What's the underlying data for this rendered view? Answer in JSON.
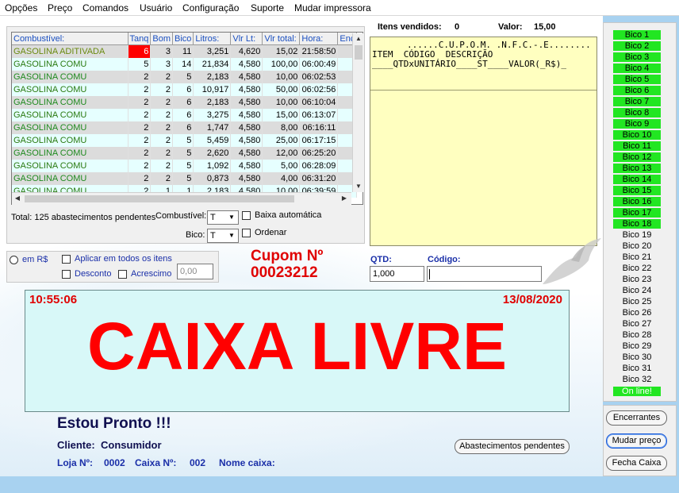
{
  "menu": [
    "Opções",
    "Preço",
    "Comandos",
    "Usuário",
    "Configuração",
    "Suporte",
    "Mudar impressora"
  ],
  "grid": {
    "headers": [
      "Combustível:",
      "Tanq",
      "Bom",
      "Bico",
      "Litros:",
      "Vlr Lt:",
      "Vlr total:",
      "Hora:",
      "Enc"
    ],
    "rows": [
      [
        "GASOLINA ADITIVADA",
        "6",
        "3",
        "11",
        "3,251",
        "4,620",
        "15,02",
        "21:58:50"
      ],
      [
        "GASOLINA COMU",
        "5",
        "3",
        "14",
        "21,834",
        "4,580",
        "100,00",
        "06:00:49"
      ],
      [
        "GASOLINA COMU",
        "2",
        "2",
        "5",
        "2,183",
        "4,580",
        "10,00",
        "06:02:53"
      ],
      [
        "GASOLINA COMU",
        "2",
        "2",
        "6",
        "10,917",
        "4,580",
        "50,00",
        "06:02:56"
      ],
      [
        "GASOLINA COMU",
        "2",
        "2",
        "6",
        "2,183",
        "4,580",
        "10,00",
        "06:10:04"
      ],
      [
        "GASOLINA COMU",
        "2",
        "2",
        "6",
        "3,275",
        "4,580",
        "15,00",
        "06:13:07"
      ],
      [
        "GASOLINA COMU",
        "2",
        "2",
        "6",
        "1,747",
        "4,580",
        "8,00",
        "06:16:11"
      ],
      [
        "GASOLINA COMU",
        "2",
        "2",
        "5",
        "5,459",
        "4,580",
        "25,00",
        "06:17:15"
      ],
      [
        "GASOLINA COMU",
        "2",
        "2",
        "5",
        "2,620",
        "4,580",
        "12,00",
        "06:25:20"
      ],
      [
        "GASOLINA COMU",
        "2",
        "2",
        "5",
        "1,092",
        "4,580",
        "5,00",
        "06:28:09"
      ],
      [
        "GASOLINA COMU",
        "2",
        "2",
        "5",
        "0,873",
        "4,580",
        "4,00",
        "06:31:20"
      ],
      [
        "GASOLINA COMU",
        "2",
        "1",
        "1",
        "2,183",
        "4,580",
        "10,00",
        "06:39:59"
      ]
    ]
  },
  "filters": {
    "total_label": "Total: 125 abastecimentos pendentes",
    "combustivel_label": "Combustível:",
    "combustivel_value": "T",
    "bico_label": "Bico:",
    "bico_value": "T",
    "baixa_label": "Baixa automática",
    "ordenar_label": "Ordenar"
  },
  "receipt": {
    "itens_label": "Itens vendidos:",
    "itens_value": "0",
    "valor_label": "Valor:",
    "valor_value": "15,00",
    "line1": "......C.U.P.O.M. .N.F.C.-.E........",
    "line2": "ITEM  CÓDIGO  DESCRIÇÃO",
    "line3": "____QTDxUNITÁRIO____ST____VALOR(_R$)_"
  },
  "options": {
    "em_rs_label": "em R$",
    "aplicar_label": "Aplicar em todos os itens",
    "desconto_label": "Desconto",
    "acrescimo_label": "Acrescimo",
    "value": "0,00"
  },
  "cupom": {
    "label": "Cupom Nº",
    "number": "00023212",
    "qtd_label": "QTD:",
    "qtd_value": "1,000",
    "codigo_label": "Código:",
    "codigo_value": ""
  },
  "display": {
    "time": "10:55:06",
    "date": "13/08/2020",
    "status": "CAIXA LIVRE"
  },
  "footer": {
    "ready": "Estou Pronto !!!",
    "cliente_label": "Cliente:",
    "cliente_value": "Consumidor",
    "loja_label": "Loja Nº:",
    "loja_value": "0002",
    "caixa_label": "Caixa Nº:",
    "caixa_value": "002",
    "nome_caixa_label": "Nome caixa:",
    "pendentes_button": "Abastecimentos pendentes"
  },
  "bicos": [
    {
      "label": "Bico 1",
      "active": true
    },
    {
      "label": "Bico 2",
      "active": true
    },
    {
      "label": "Bico 3",
      "active": true
    },
    {
      "label": "Bico 4",
      "active": true
    },
    {
      "label": "Bico 5",
      "active": true
    },
    {
      "label": "Bico 6",
      "active": true
    },
    {
      "label": "Bico 7",
      "active": true
    },
    {
      "label": "Bico 8",
      "active": true
    },
    {
      "label": "Bico 9",
      "active": true
    },
    {
      "label": "Bico 10",
      "active": true
    },
    {
      "label": "Bico 11",
      "active": true
    },
    {
      "label": "Bico 12",
      "active": true
    },
    {
      "label": "Bico 13",
      "active": true
    },
    {
      "label": "Bico 14",
      "active": true
    },
    {
      "label": "Bico 15",
      "active": true
    },
    {
      "label": "Bico 16",
      "active": true
    },
    {
      "label": "Bico 17",
      "active": true
    },
    {
      "label": "Bico 18",
      "active": true
    },
    {
      "label": "Bico 19",
      "active": false
    },
    {
      "label": "Bico 20",
      "active": false
    },
    {
      "label": "Bico 21",
      "active": false
    },
    {
      "label": "Bico 22",
      "active": false
    },
    {
      "label": "Bico 23",
      "active": false
    },
    {
      "label": "Bico 24",
      "active": false
    },
    {
      "label": "Bico 25",
      "active": false
    },
    {
      "label": "Bico 26",
      "active": false
    },
    {
      "label": "Bico 27",
      "active": false
    },
    {
      "label": "Bico 28",
      "active": false
    },
    {
      "label": "Bico 29",
      "active": false
    },
    {
      "label": "Bico 30",
      "active": false
    },
    {
      "label": "Bico 31",
      "active": false
    },
    {
      "label": "Bico 32",
      "active": false
    }
  ],
  "online_label": "On line!",
  "side_buttons": {
    "encerrantes": "Encerrantes",
    "mudar_preco": "Mudar preço",
    "fecha_caixa": "Fecha Caixa"
  },
  "colors": {
    "red": "#ff0000",
    "blue_text": "#1a2fa8",
    "green_text": "#1f8a1f",
    "active_bico": "#22e622",
    "selected_cell": "#ff0000"
  }
}
